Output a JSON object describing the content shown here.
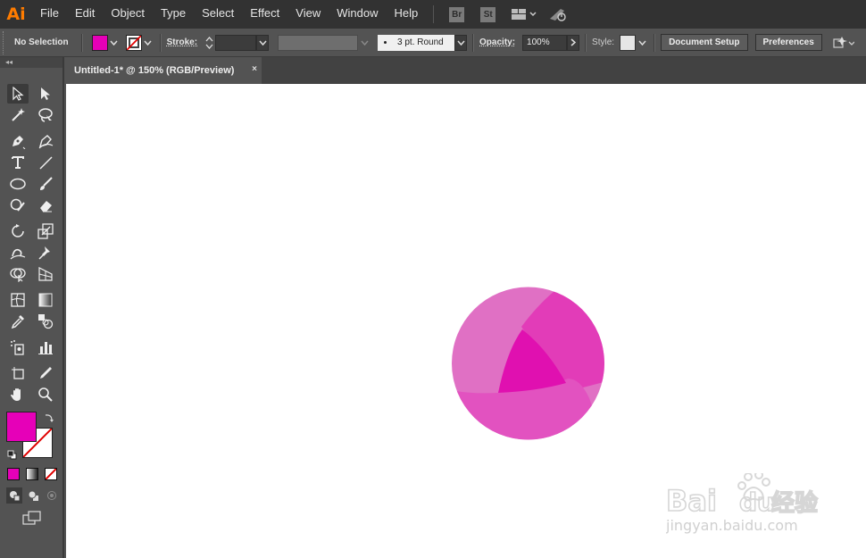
{
  "app": {
    "logo_text": "Ai"
  },
  "menu": {
    "items": [
      "File",
      "Edit",
      "Object",
      "Type",
      "Select",
      "Effect",
      "View",
      "Window",
      "Help"
    ]
  },
  "apps": {
    "bridge": "Br",
    "stock": "St"
  },
  "control_bar": {
    "selection_label": "No Selection",
    "fill_color": "#e600b8",
    "stroke_label": "Stroke:",
    "brush_label": "3 pt. Round",
    "opacity_label": "Opacity:",
    "opacity_value": "100%",
    "style_label": "Style:",
    "document_setup": "Document Setup",
    "preferences": "Preferences"
  },
  "document": {
    "tab_title": "Untitled-1* @ 150% (RGB/Preview)",
    "close_glyph": "×"
  },
  "toolbar": {
    "collapse_glyph": "◂◂",
    "fill_color": "#e600b8"
  },
  "artwork": {
    "colors": {
      "light": "#e070c4",
      "mid": "#e23cb8",
      "dark": "#e010b0",
      "lower": "#e252c0"
    }
  },
  "watermark": {
    "brand_latin": "Bai",
    "brand_du": "du",
    "brand_cn": "经验",
    "url": "jingyan.baidu.com"
  }
}
